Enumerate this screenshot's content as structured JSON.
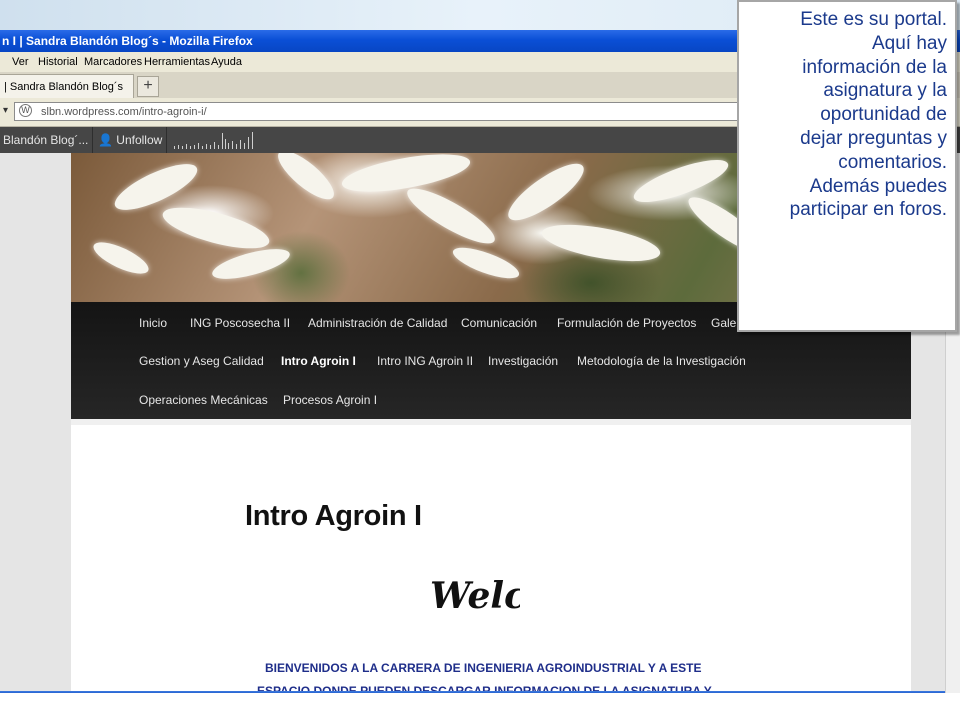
{
  "window": {
    "title": "n I | Sandra Blandón Blog´s - Mozilla Firefox"
  },
  "menu": {
    "items": [
      "Ver",
      "Historial",
      "Marcadores",
      "Herramientas",
      "Ayuda"
    ]
  },
  "tabs": [
    {
      "label": "| Sandra Blandón Blog´s"
    }
  ],
  "new_tab_symbol": "+",
  "address": {
    "url": "slbn.wordpress.com/intro-agroin-i/"
  },
  "wp_toolbar": {
    "blog": "Blandón Blog´...",
    "unfollow": "Unfollow"
  },
  "site_nav": {
    "row1": [
      "Inicio",
      "ING Poscosecha II",
      "Administración de Calidad",
      "Comunicación",
      "Formulación de Proyectos",
      "Gale"
    ],
    "row2": [
      "Gestion y Aseg Calidad",
      "Intro Agroin I",
      "Intro ING Agroin II",
      "Investigación",
      "Metodología de la Investigación"
    ],
    "row3": [
      "Operaciones Mecánicas",
      "Procesos Agroin I"
    ]
  },
  "page": {
    "title": "Intro Agroin I",
    "welcome": "Welcome",
    "body_line1": "BIENVENIDOS A LA CARRERA DE INGENIERIA AGROINDUSTRIAL Y A ESTE",
    "body_line2": "ESPACIO DONDE PUEDEN DESCARGAR INFORMACION DE LA ASIGNATURA Y"
  },
  "callout": {
    "lines": [
      "Este es su portal.",
      "Aquí hay",
      "información de la",
      "asignatura y la",
      "oportunidad de",
      "dejar preguntas y",
      "comentarios.",
      "Además puedes",
      "participar en foros."
    ]
  }
}
